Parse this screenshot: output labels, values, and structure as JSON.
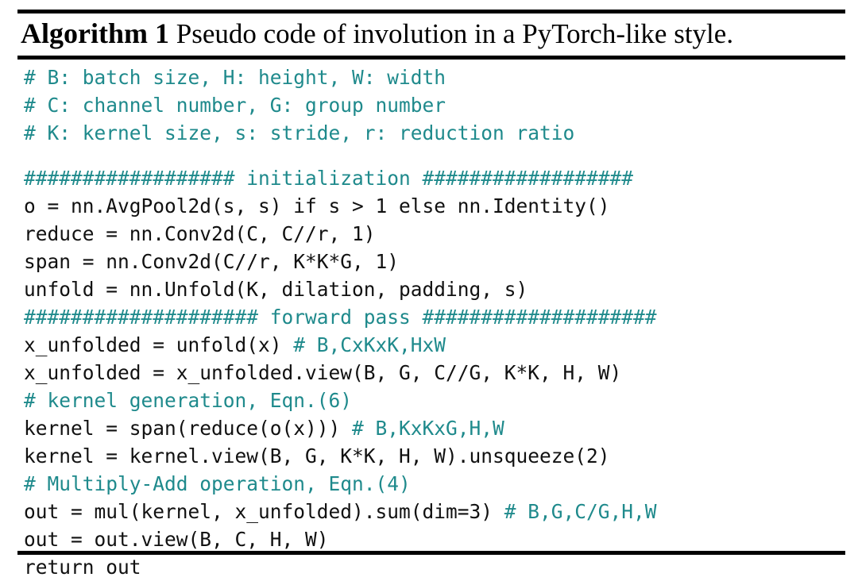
{
  "document": {
    "type": "algorithm-float",
    "colors": {
      "comment": "#1f8a8c",
      "code": "#111111",
      "rule": "#000000",
      "background": "#ffffff"
    }
  },
  "caption": {
    "label": "Algorithm 1",
    "text": " Pseudo code of involution in a PyTorch-like style.",
    "full": "Algorithm 1 Pseudo code of involution in a PyTorch-like style."
  },
  "code": {
    "language": "python",
    "lines": [
      {
        "id": "l01",
        "kind": "comment",
        "blank": false,
        "comment": "# B: batch size, H: height, W: width",
        "code": ""
      },
      {
        "id": "l02",
        "kind": "comment",
        "blank": false,
        "comment": "# C: channel number, G: group number",
        "code": ""
      },
      {
        "id": "l03",
        "kind": "comment",
        "blank": false,
        "comment": "# K: kernel size, s: stride, r: reduction ratio",
        "code": ""
      },
      {
        "id": "l04",
        "kind": "blank",
        "blank": true,
        "comment": "",
        "code": ""
      },
      {
        "id": "l05",
        "kind": "comment",
        "blank": false,
        "comment": "################## initialization ##################",
        "code": ""
      },
      {
        "id": "l06",
        "kind": "code",
        "blank": false,
        "comment": "",
        "code": "o = nn.AvgPool2d(s, s) if s > 1 else nn.Identity()"
      },
      {
        "id": "l07",
        "kind": "code",
        "blank": false,
        "comment": "",
        "code": "reduce = nn.Conv2d(C, C//r, 1)"
      },
      {
        "id": "l08",
        "kind": "code",
        "blank": false,
        "comment": "",
        "code": "span = nn.Conv2d(C//r, K*K*G, 1)"
      },
      {
        "id": "l09",
        "kind": "code",
        "blank": false,
        "comment": "",
        "code": "unfold = nn.Unfold(K, dilation, padding, s)"
      },
      {
        "id": "l10",
        "kind": "comment",
        "blank": false,
        "comment": "#################### forward pass ####################",
        "code": ""
      },
      {
        "id": "l11",
        "kind": "code-comment",
        "blank": false,
        "comment": "# B,CxKxK,HxW",
        "code": "x_unfolded = unfold(x) "
      },
      {
        "id": "l12",
        "kind": "code",
        "blank": false,
        "comment": "",
        "code": "x_unfolded = x_unfolded.view(B, G, C//G, K*K, H, W)"
      },
      {
        "id": "l13",
        "kind": "comment",
        "blank": false,
        "comment": "# kernel generation, Eqn.(6)",
        "code": ""
      },
      {
        "id": "l14",
        "kind": "code-comment",
        "blank": false,
        "comment": "# B,KxKxG,H,W",
        "code": "kernel = span(reduce(o(x))) "
      },
      {
        "id": "l15",
        "kind": "code",
        "blank": false,
        "comment": "",
        "code": "kernel = kernel.view(B, G, K*K, H, W).unsqueeze(2)"
      },
      {
        "id": "l16",
        "kind": "comment",
        "blank": false,
        "comment": "# Multiply-Add operation, Eqn.(4)",
        "code": ""
      },
      {
        "id": "l17",
        "kind": "code-comment",
        "blank": false,
        "comment": "# B,G,C/G,H,W",
        "code": "out = mul(kernel, x_unfolded).sum(dim=3) "
      },
      {
        "id": "l18",
        "kind": "code",
        "blank": false,
        "comment": "",
        "code": "out = out.view(B, C, H, W)"
      },
      {
        "id": "l19",
        "kind": "code",
        "blank": false,
        "comment": "",
        "code": "return out"
      }
    ]
  }
}
